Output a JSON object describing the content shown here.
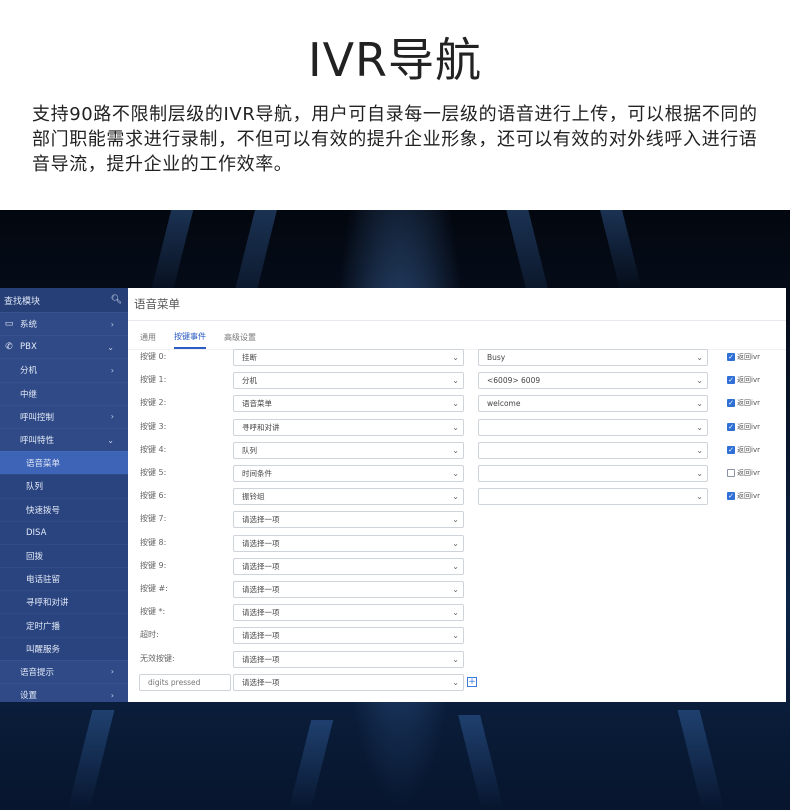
{
  "hero": {
    "title": "IVR导航",
    "description": "支持90路不限制层级的IVR导航，用户可自录每一层级的语音进行上传，可以根据不同的部门职能需求进行录制，不但可以有效的提升企业形象，还可以有效的对外线呼入进行语音导流，提升企业的工作效率。"
  },
  "sidebar": {
    "search_label": "查找模块",
    "items": [
      {
        "label": "系统",
        "icon": "monitor-icon",
        "level": "top",
        "chevron": "›"
      },
      {
        "label": "PBX",
        "icon": "phone-icon",
        "level": "top",
        "chevron": "⌄"
      },
      {
        "label": "分机",
        "level": "l1",
        "chevron": "›"
      },
      {
        "label": "中继",
        "level": "l1",
        "chevron": ""
      },
      {
        "label": "呼叫控制",
        "level": "l1",
        "chevron": "›"
      },
      {
        "label": "呼叫特性",
        "level": "l1",
        "chevron": "⌄"
      },
      {
        "label": "语音菜单",
        "level": "l2",
        "chevron": "",
        "active": true
      },
      {
        "label": "队列",
        "level": "l2",
        "chevron": ""
      },
      {
        "label": "快速拨号",
        "level": "l2",
        "chevron": ""
      },
      {
        "label": "DISA",
        "level": "l2",
        "chevron": ""
      },
      {
        "label": "回拨",
        "level": "l2",
        "chevron": ""
      },
      {
        "label": "电话驻留",
        "level": "l2",
        "chevron": ""
      },
      {
        "label": "寻呼和对讲",
        "level": "l2",
        "chevron": ""
      },
      {
        "label": "定时广播",
        "level": "l2",
        "chevron": ""
      },
      {
        "label": "叫醒服务",
        "level": "l2",
        "chevron": ""
      },
      {
        "label": "语音提示",
        "level": "l1",
        "chevron": "›"
      },
      {
        "label": "设置",
        "level": "l1",
        "chevron": "›"
      }
    ]
  },
  "panel": {
    "title": "语音菜单",
    "tabs": [
      {
        "label": "通用",
        "active": false
      },
      {
        "label": "按键事件",
        "active": true
      },
      {
        "label": "高级设置",
        "active": false
      }
    ],
    "rows": [
      {
        "label": "按键 0:",
        "action": "挂断",
        "target": "Busy",
        "has_target": true,
        "return": true
      },
      {
        "label": "按键 1:",
        "action": "分机",
        "target": "<6009> 6009",
        "has_target": true,
        "return": true
      },
      {
        "label": "按键 2:",
        "action": "语音菜单",
        "target": "welcome",
        "has_target": true,
        "return": true
      },
      {
        "label": "按键 3:",
        "action": "寻呼和对讲",
        "target": "",
        "has_target": true,
        "return": true
      },
      {
        "label": "按键 4:",
        "action": "队列",
        "target": "",
        "has_target": true,
        "return": true
      },
      {
        "label": "按键 5:",
        "action": "时间条件",
        "target": "",
        "has_target": true,
        "return": false
      },
      {
        "label": "按键 6:",
        "action": "振铃组",
        "target": "",
        "has_target": true,
        "return": true
      },
      {
        "label": "按键 7:",
        "action": "请选择一项",
        "has_target": false
      },
      {
        "label": "按键 8:",
        "action": "请选择一项",
        "has_target": false
      },
      {
        "label": "按键 9:",
        "action": "请选择一项",
        "has_target": false
      },
      {
        "label": "按键 #:",
        "action": "请选择一项",
        "has_target": false
      },
      {
        "label": "按键 *:",
        "action": "请选择一项",
        "has_target": false
      },
      {
        "label": "超时:",
        "action": "请选择一项",
        "has_target": false
      },
      {
        "label": "无效按键:",
        "action": "请选择一项",
        "has_target": false
      }
    ],
    "return_label": "返回ivr",
    "digits_placeholder": "digits pressed",
    "digits_action": "请选择一项",
    "add_symbol": "+"
  },
  "icons": {
    "search": "search-icon",
    "dropdown": "chevron-down-icon",
    "add": "plus-icon",
    "checkbox_mark": "✓"
  },
  "colors": {
    "sidebar": "#2f4a86",
    "active_item": "#3e64b8",
    "accent": "#2c5bc4"
  }
}
